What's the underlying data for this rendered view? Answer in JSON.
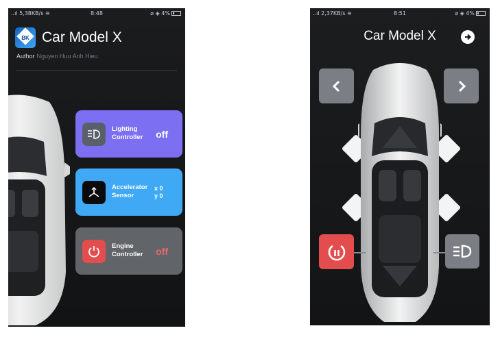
{
  "left_screen": {
    "status": {
      "signal": "..ıl 5,38KB/s ≋",
      "time": "8:48",
      "right": "⌀ ◈ 4%"
    },
    "app": {
      "logo_text": "BK",
      "title": "Car Model X",
      "author_label": "Author",
      "author_name": "Nguyen Huu Anh Hieu"
    },
    "cards": {
      "lighting": {
        "label": "Lighting Controller",
        "state": "off",
        "icon": "headlight-icon"
      },
      "accelerator": {
        "label": "Accelerator Sensor",
        "x": "x 0",
        "y": "y 0",
        "icon": "axes-icon"
      },
      "engine": {
        "label": "Engine Controller",
        "state": "off",
        "icon": "power-icon"
      }
    },
    "colors": {
      "lighting": "#7c6ff2",
      "accelerator": "#3fa9f5",
      "engine": "#616469",
      "engine_state": "#e86a6a"
    }
  },
  "right_screen": {
    "status": {
      "signal": "..ıl 2,37KB/s ≋",
      "time": "8:51",
      "right": "⌀ ◈ 4%"
    },
    "title": "Car Model X",
    "buttons": {
      "next": "arrow-right-circle-icon",
      "steer_left": "chevron-left-icon",
      "steer_right": "chevron-right-icon",
      "engine": "power-icon",
      "light": "headlight-icon"
    },
    "colors": {
      "button": "#7b7e84",
      "engine_button": "#e34d4d"
    }
  }
}
